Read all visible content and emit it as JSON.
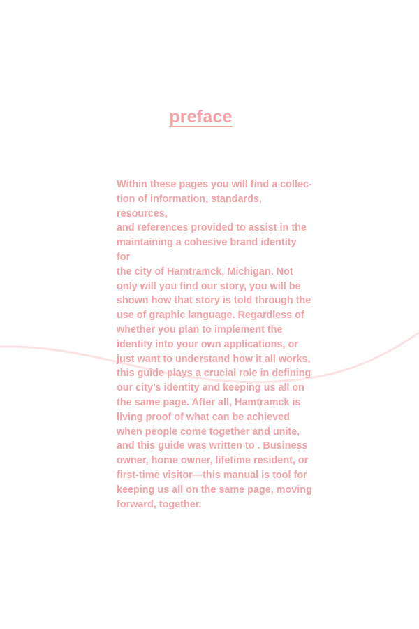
{
  "document": {
    "title": "preface",
    "paragraph": "Within these pages you will find a collec-\ntion of information, standards, resources,\nand references provided to assist in the\nmaintaining a cohesive brand identity for\nthe city of Hamtramck, Michigan. Not\nonly will you find our story, you will be\nshown how that story is told through the\nuse of graphic language. Regardless of\nwhether you plan to implement the\nidentity into your own applications, or\njust want to understand how it all works,\nthis guide plays a crucial role in defining\nour city’s identity and keeping us all on\nthe same page.  After all, Hamtramck is\nliving proof of what can be achieved\nwhen people come together and unite,\nand this guide was written to . Business\nowner, home owner, lifetime resident, or\nfirst-time visitor—this manual is tool for\nkeeping us all on the same page, moving\nforward, together."
  },
  "colors": {
    "text": "#f3a3a6",
    "wave": "#fbe3e4",
    "background": "#ffffff"
  }
}
